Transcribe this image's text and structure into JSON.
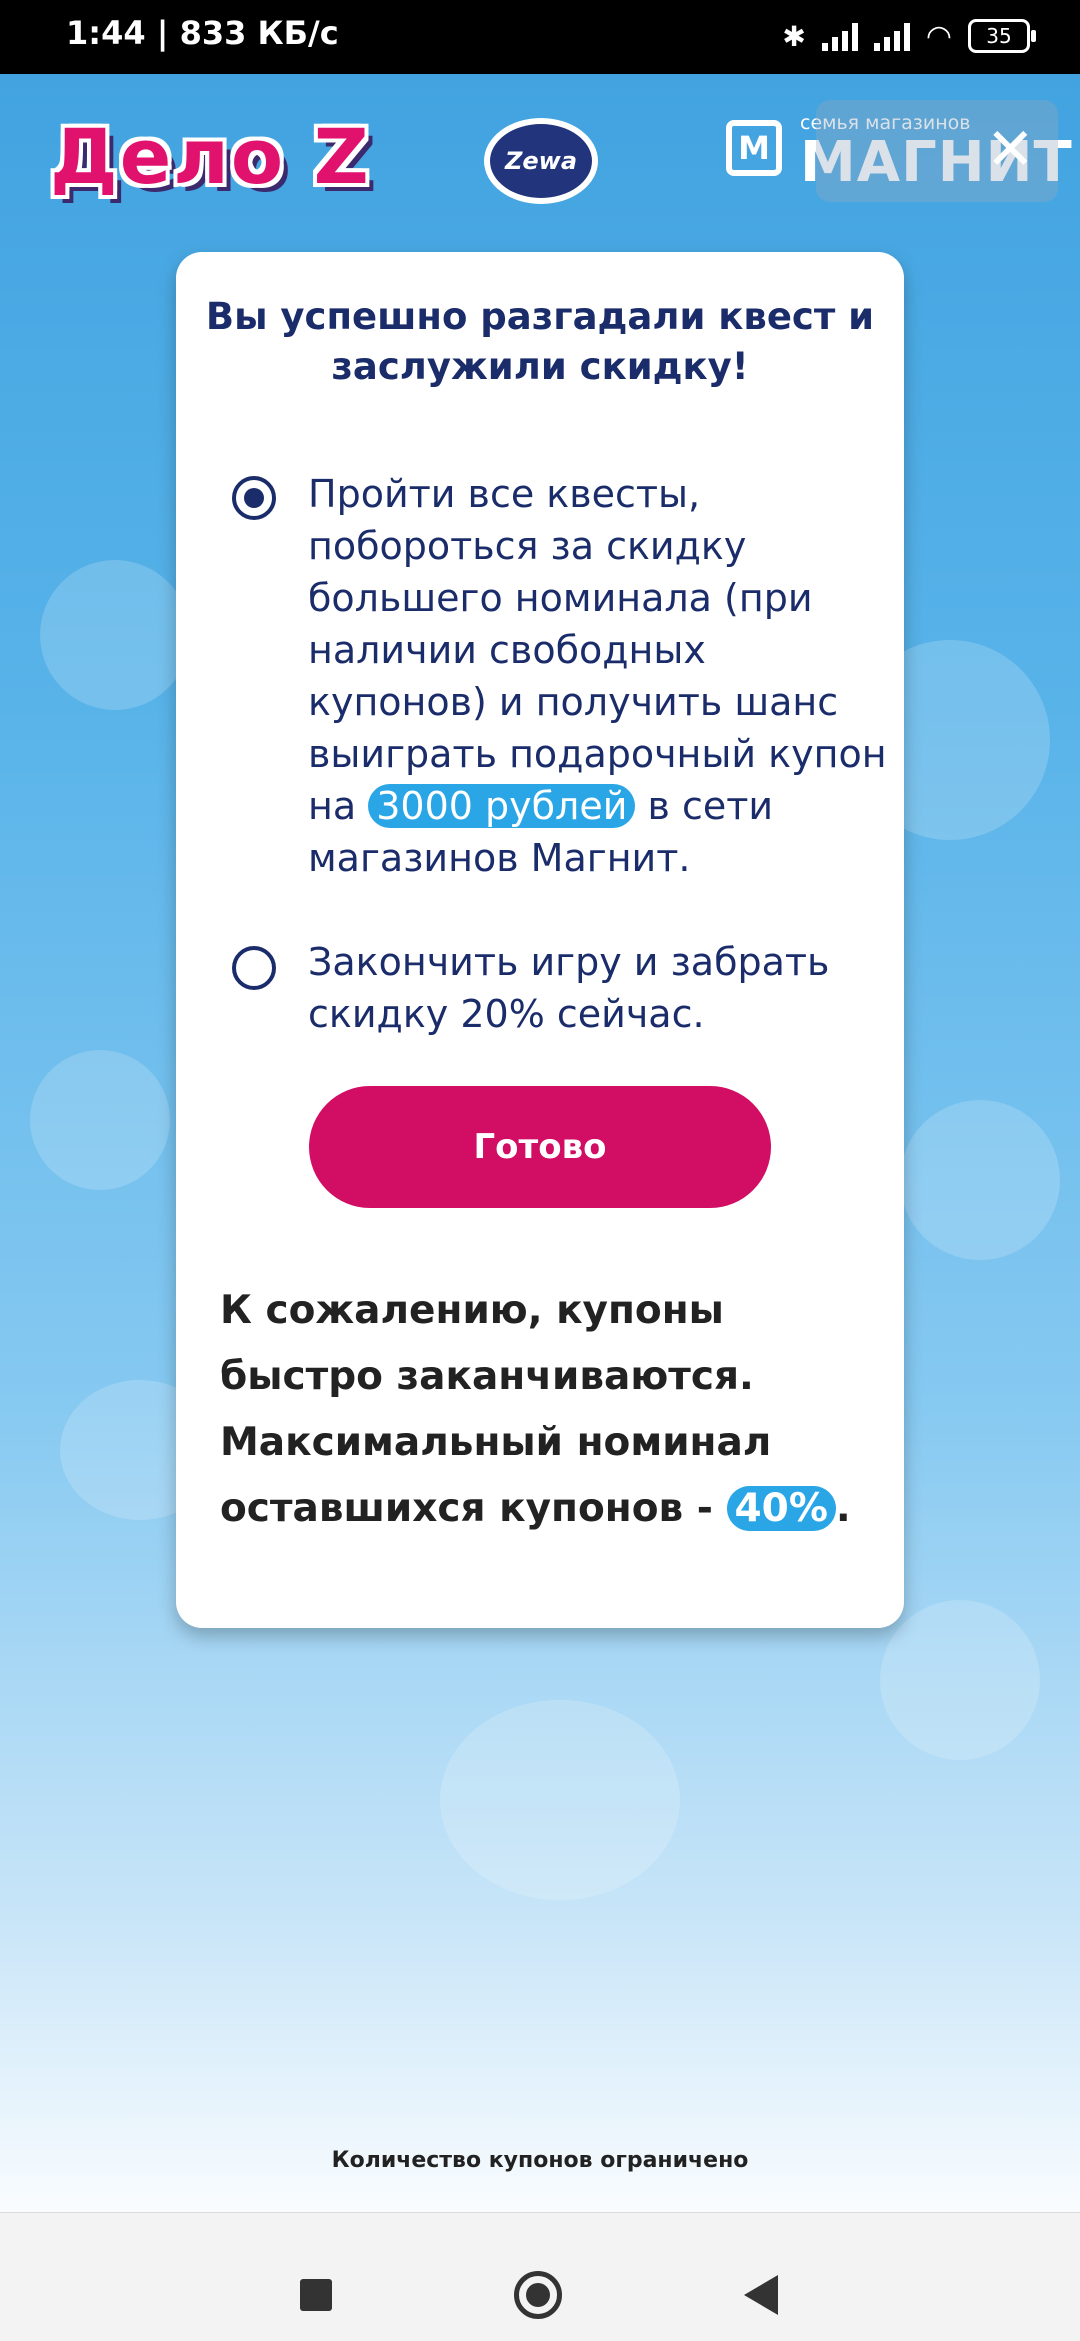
{
  "status_bar": {
    "time": "1:44",
    "speed": "| 833 КБ/с",
    "battery": "35"
  },
  "header": {
    "brand_left": "Дело Z",
    "brand_center": "Zewa",
    "brand_right_sub": "семья магазинов",
    "brand_right": "МАГНИТ",
    "close_symbol": "✕"
  },
  "card": {
    "title": "Вы успешно разгадали квест и заслужили скидку!",
    "options": [
      {
        "selected": true,
        "text_before": "Пройти все квесты, побороться за скидку большего номинала (при наличии свободных купонов) и получить шанс выиграть подарочный купон на ",
        "highlight": "3000 рублей",
        "text_after": " в сети магазинов Магнит."
      },
      {
        "selected": false,
        "text": "Закончить игру и забрать скидку 20% сейчас."
      }
    ],
    "submit_label": "Готово",
    "note_text": "К сожалению, купоны быстро заканчиваются. Максимальный номинал оставшихся купонов - ",
    "note_highlight": "40%",
    "note_end": "."
  },
  "footer_text": "Количество купонов ограничено",
  "colors": {
    "accent": "#d10d64",
    "primary_text": "#1b2c6b",
    "highlight": "#2aa6e6"
  }
}
